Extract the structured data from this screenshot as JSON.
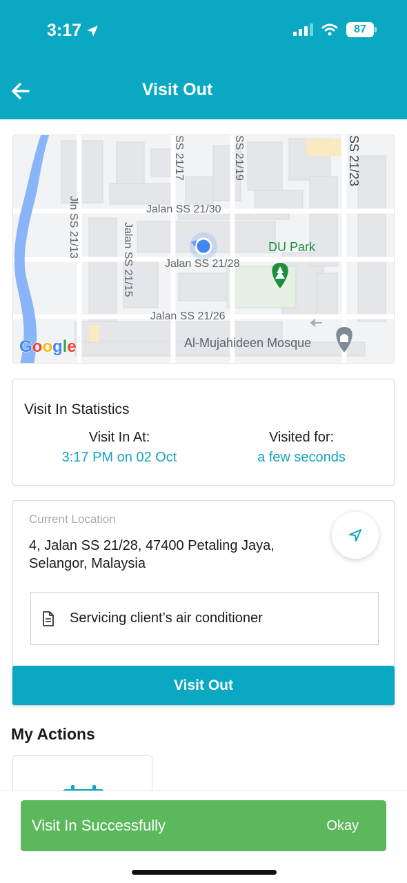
{
  "status_bar": {
    "time": "3:17",
    "battery": "87"
  },
  "header": {
    "title": "Visit Out"
  },
  "map": {
    "labels": {
      "jalan_ss_21_30": "Jalan SS 21/30",
      "jalan_ss_21_28": "Jalan SS 21/28",
      "jalan_ss_21_26": "Jalan SS 21/26",
      "jalan_ss_21_15": "Jalan SS 21/15",
      "jln_ss_21_13": "Jln SS 21/13",
      "ss_21_17": "SS 21/17",
      "ss_21_19": "SS 21/19",
      "ss_21_23": "SS 21/23",
      "du_park": "DU Park",
      "mosque": "Al-Mujahideen Mosque"
    },
    "google": [
      "G",
      "o",
      "o",
      "g",
      "l",
      "e"
    ],
    "colors": {
      "river": "#8ab4f8",
      "park": "#1e8e3e",
      "location": "#4285f4"
    }
  },
  "stats": {
    "title": "Visit In Statistics",
    "visit_in_label": "Visit In At:",
    "visit_in_value": "3:17 PM on 02 Oct",
    "visited_for_label": "Visited for:",
    "visited_for_value": "a few seconds"
  },
  "location": {
    "label": "Current Location",
    "address": "4, Jalan SS 21/28, 47400 Petaling Jaya, Selangor, Malaysia",
    "note": "Servicing client’s air conditioner",
    "button": "Visit Out"
  },
  "my_actions": {
    "title": "My Actions"
  },
  "toast": {
    "message": "Visit In Successfully",
    "action": "Okay"
  },
  "colors": {
    "primary": "#0aa8c2",
    "accent_text": "#16a3bd",
    "success": "#5cb85c"
  }
}
